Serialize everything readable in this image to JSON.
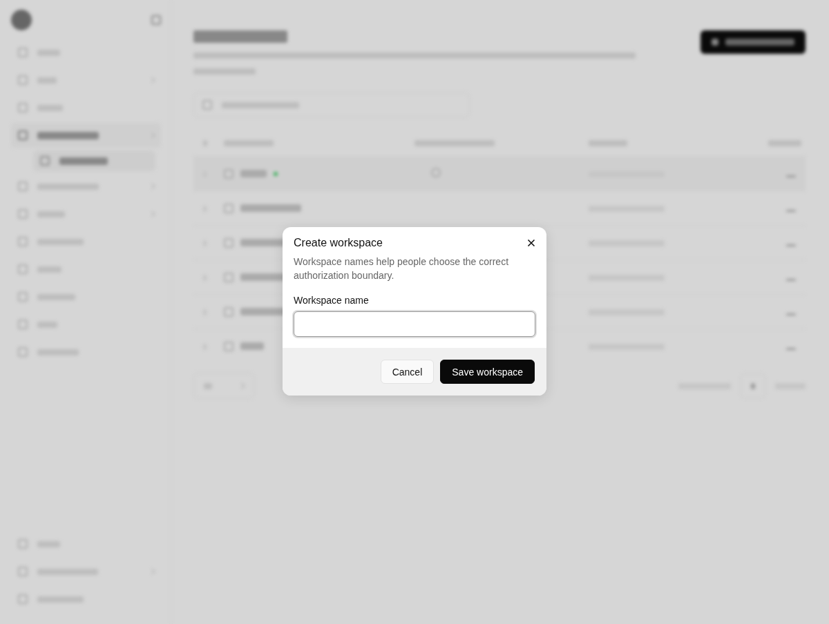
{
  "dialog": {
    "title": "Create workspace",
    "description": "Workspace names help people choose the correct authorization boundary.",
    "field_label": "Workspace name",
    "cancel": "Cancel",
    "save": "Save workspace"
  }
}
